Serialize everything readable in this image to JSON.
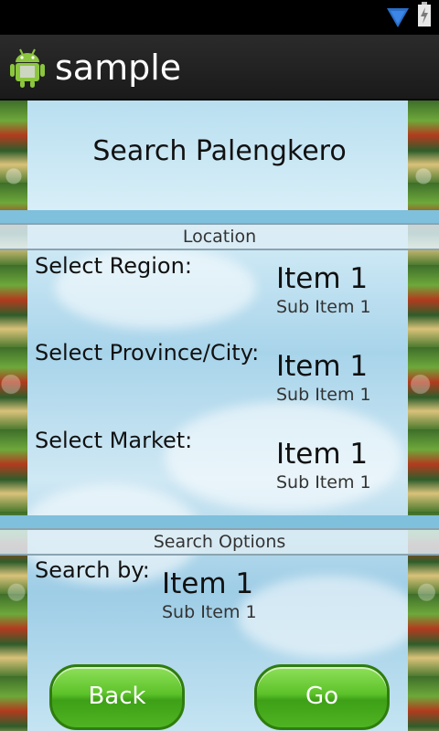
{
  "app": {
    "title": "sample",
    "icon": "android-icon"
  },
  "status_bar": {
    "icons": [
      "wifi-icon",
      "battery-charging-icon"
    ]
  },
  "page_title": "Search Palengkero",
  "location": {
    "header": "Location",
    "region": {
      "label": "Select Region:",
      "value": "Item 1",
      "sub": "Sub Item 1"
    },
    "province": {
      "label": "Select Province/City:",
      "value": "Item 1",
      "sub": "Sub Item 1"
    },
    "market": {
      "label": "Select Market:",
      "value": "Item 1",
      "sub": "Sub Item 1"
    }
  },
  "search_options": {
    "header": "Search Options",
    "search_by": {
      "label": "Search by:",
      "value": "Item 1",
      "sub": "Sub Item 1"
    }
  },
  "buttons": {
    "back": "Back",
    "go": "Go"
  },
  "colors": {
    "button_green": "#5cc229",
    "accent_blue": "#7fc0dd",
    "action_bar": "#222222"
  }
}
